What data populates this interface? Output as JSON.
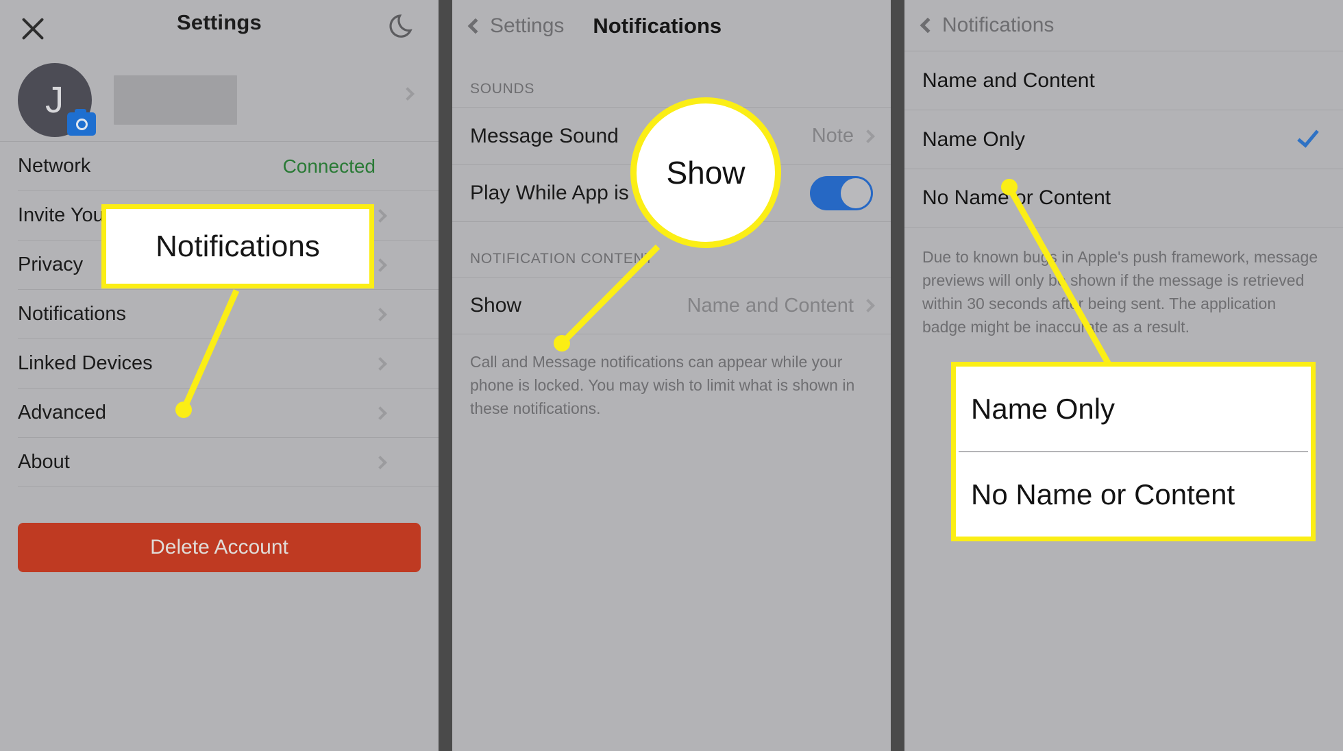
{
  "panels": {
    "settings": {
      "title": "Settings",
      "close_icon": "close-x-icon",
      "theme_icon": "moon-icon",
      "profile": {
        "avatar_initial": "J",
        "badge_icon": "camera-icon",
        "chevron_icon": "chevron-right-icon"
      },
      "rows": [
        {
          "label": "Network",
          "value": "Connected",
          "value_color": "#2a7a36"
        },
        {
          "label": "Invite Your Friends",
          "value": ""
        },
        {
          "label": "Privacy",
          "value": ""
        },
        {
          "label": "Notifications",
          "value": ""
        },
        {
          "label": "Linked Devices",
          "value": ""
        },
        {
          "label": "Advanced",
          "value": ""
        },
        {
          "label": "About",
          "value": ""
        }
      ],
      "delete_button": "Delete Account"
    },
    "notifications": {
      "back_label": "Settings",
      "title": "Notifications",
      "sections": [
        {
          "header": "SOUNDS",
          "rows": [
            {
              "label": "Message Sound",
              "value": "Note",
              "control": "chevron"
            },
            {
              "label": "Play While App is Open",
              "value": "",
              "control": "toggle-on"
            }
          ]
        },
        {
          "header": "NOTIFICATION CONTENT",
          "rows": [
            {
              "label": "Show",
              "value": "Name and Content",
              "control": "chevron"
            }
          ]
        }
      ],
      "footer_note": "Call and Message notifications can appear while your phone is locked. You may wish to limit what is shown in these notifications."
    },
    "show_options": {
      "back_label": "Notifications",
      "options": [
        {
          "label": "Name and Content",
          "selected": false
        },
        {
          "label": "Name Only",
          "selected": true
        },
        {
          "label": "No Name or Content",
          "selected": false
        }
      ],
      "footer_note": "Due to known bugs in Apple's push framework, message previews will only be shown if the message is retrieved within 30 seconds after being sent. The application badge might be inaccurate as a result."
    }
  },
  "callouts": {
    "notifications": {
      "text": "Notifications"
    },
    "show": {
      "text": "Show"
    },
    "options": {
      "option_1": "Name Only",
      "option_2": "No Name or Content"
    }
  },
  "colors": {
    "highlight": "#fbee15",
    "accent_blue": "#2668c4",
    "danger_red": "#bf3a22",
    "status_green": "#2a7a36",
    "panel_bg": "#b3b3b6",
    "gap": "#4a4a4a"
  }
}
